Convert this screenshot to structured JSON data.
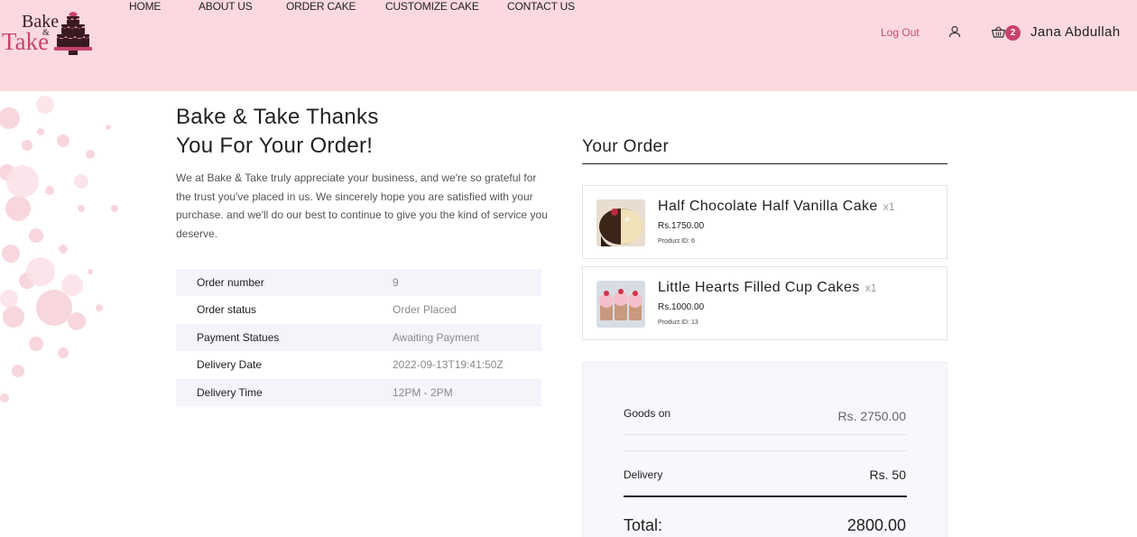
{
  "brand": {
    "logo_line1": "Bake",
    "logo_amp": "&",
    "logo_line2": "Take"
  },
  "nav": {
    "items": [
      "HOME",
      "ABOUT US",
      "ORDER CAKE",
      "CUSTOMIZE CAKE",
      "CONTACT US"
    ]
  },
  "account": {
    "logout_label": "Log Out",
    "user_icon": "user-icon",
    "cart_icon": "basket-icon",
    "cart_count": "2",
    "user_name": "Jana Abdullah"
  },
  "thanks": {
    "title_line1": "Bake & Take Thanks",
    "title_line2": "You For Your Order!",
    "body": "We at Bake & Take truly appreciate your business, and we're so grateful for the trust you've placed in us. We sincerely hope you are satisfied with your purchase. and we'll do our best to continue to give you the kind of service you deserve."
  },
  "order_details": [
    {
      "label": "Order number",
      "value": "9"
    },
    {
      "label": "Order status",
      "value": "Order Placed"
    },
    {
      "label": "Payment Statues",
      "value": "Awaiting Payment"
    },
    {
      "label": "Delivery Date",
      "value": "2022-09-13T19:41:50Z"
    },
    {
      "label": "Delivery Time",
      "value": "12PM - 2PM"
    }
  ],
  "your_order": {
    "heading": "Your Order",
    "items": [
      {
        "name": "Half Chocolate Half Vanilla Cake",
        "qty": "x1",
        "price": "Rs.1750.00",
        "product_id": "Product ID: 6"
      },
      {
        "name": "Little Hearts Filled Cup Cakes",
        "qty": "x1",
        "price": "Rs.1000.00",
        "product_id": "Product ID: 13"
      }
    ]
  },
  "summary": {
    "goods_label": "Goods on",
    "goods_value": "Rs. 2750.00",
    "delivery_label": "Delivery",
    "delivery_value": "Rs. 50",
    "total_label": "Total:",
    "total_value": "2800.00"
  },
  "colors": {
    "header_bg": "#fbd9df",
    "accent": "#c8436e",
    "summary_bg": "#f8f7fc",
    "row_alt_bg": "#f4f4fb"
  }
}
